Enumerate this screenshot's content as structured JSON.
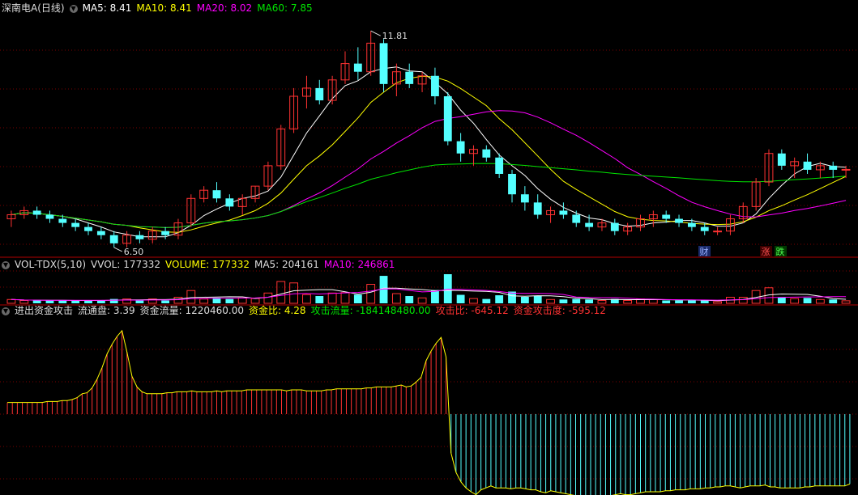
{
  "colors": {
    "up": "#ff3232",
    "down": "#54ffff",
    "ma5": "#ffffff",
    "ma10": "#ffff00",
    "ma20": "#ff00ff",
    "ma60": "#00e600",
    "grid": "#7a0000",
    "label_white": "#dddddd",
    "cyan_text": "#54ffff",
    "green_text": "#00e600",
    "red_text": "#ff3232"
  },
  "icons": {
    "panel_toggle": "circle-chevron-down-icon"
  },
  "main": {
    "title": "深南电A(日线)",
    "ma5": "MA5: 8.41",
    "ma10": "MA10: 8.41",
    "ma20": "MA20: 8.02",
    "ma60": "MA60: 7.85",
    "high_label": "11.81",
    "low_label": "6.50",
    "markers": {
      "cai": "财",
      "zhang": "涨",
      "die": "跌"
    }
  },
  "volume": {
    "title": "VOL-TDX(5,10)",
    "vvol": "VVOL: 177332",
    "volume": "VOLUME: 177332",
    "ma5": "MA5: 204161",
    "ma10": "MA10: 246861"
  },
  "indicator": {
    "title": "进出资金攻击",
    "liutongpan": "流通盘: 3.39",
    "zijinliuliang": "资金流量: 1220460.00",
    "zijinbi": "资金比: 4.28",
    "gongjiliuliang": "攻击流量: -184148480.00",
    "gongjibi": "攻击比: -645.12",
    "zijingongjidu": "资金攻击度: -595.12"
  },
  "chart_data": [
    {
      "type": "candlestick",
      "title": "深南电A(日线)",
      "ylim": [
        6.3,
        12.2
      ],
      "ohlc_approx": [
        [
          7.2,
          7.4,
          7.0,
          7.3
        ],
        [
          7.3,
          7.5,
          7.2,
          7.4
        ],
        [
          7.4,
          7.5,
          7.2,
          7.3
        ],
        [
          7.3,
          7.4,
          7.1,
          7.2
        ],
        [
          7.2,
          7.3,
          7.0,
          7.1
        ],
        [
          7.1,
          7.2,
          6.9,
          7.0
        ],
        [
          7.0,
          7.1,
          6.8,
          6.9
        ],
        [
          6.9,
          7.0,
          6.7,
          6.8
        ],
        [
          6.8,
          6.9,
          6.5,
          6.6
        ],
        [
          6.6,
          6.9,
          6.5,
          6.8
        ],
        [
          6.8,
          6.9,
          6.6,
          6.7
        ],
        [
          6.7,
          7.0,
          6.6,
          6.9
        ],
        [
          6.9,
          7.0,
          6.7,
          6.8
        ],
        [
          6.8,
          7.2,
          6.7,
          7.1
        ],
        [
          7.1,
          7.8,
          7.0,
          7.7
        ],
        [
          7.7,
          8.0,
          7.6,
          7.9
        ],
        [
          7.9,
          8.1,
          7.6,
          7.7
        ],
        [
          7.7,
          7.8,
          7.4,
          7.5
        ],
        [
          7.5,
          7.8,
          7.3,
          7.7
        ],
        [
          7.7,
          8.0,
          7.6,
          8.0
        ],
        [
          8.0,
          8.6,
          7.9,
          8.5
        ],
        [
          8.5,
          9.5,
          8.4,
          9.4
        ],
        [
          9.4,
          10.4,
          9.3,
          10.2
        ],
        [
          10.2,
          10.7,
          9.9,
          10.4
        ],
        [
          10.4,
          10.6,
          10.0,
          10.1
        ],
        [
          10.1,
          10.7,
          10.0,
          10.6
        ],
        [
          10.6,
          11.3,
          10.5,
          11.0
        ],
        [
          11.0,
          11.4,
          10.6,
          10.8
        ],
        [
          10.8,
          11.8,
          10.7,
          11.5
        ],
        [
          11.5,
          11.6,
          10.3,
          10.5
        ],
        [
          10.5,
          11.0,
          10.2,
          10.8
        ],
        [
          10.8,
          11.0,
          10.4,
          10.5
        ],
        [
          10.5,
          10.8,
          10.3,
          10.7
        ],
        [
          10.7,
          10.9,
          10.0,
          10.2
        ],
        [
          10.2,
          10.3,
          9.0,
          9.1
        ],
        [
          9.1,
          9.3,
          8.6,
          8.8
        ],
        [
          8.8,
          9.0,
          8.5,
          8.9
        ],
        [
          8.9,
          9.0,
          8.6,
          8.7
        ],
        [
          8.7,
          8.8,
          8.2,
          8.3
        ],
        [
          8.3,
          8.4,
          7.6,
          7.8
        ],
        [
          7.8,
          8.0,
          7.4,
          7.6
        ],
        [
          7.6,
          7.8,
          7.2,
          7.3
        ],
        [
          7.3,
          7.5,
          7.1,
          7.4
        ],
        [
          7.4,
          7.6,
          7.2,
          7.3
        ],
        [
          7.3,
          7.4,
          7.0,
          7.1
        ],
        [
          7.1,
          7.3,
          6.9,
          7.0
        ],
        [
          7.0,
          7.2,
          6.9,
          7.1
        ],
        [
          7.1,
          7.2,
          6.8,
          6.9
        ],
        [
          6.9,
          7.1,
          6.8,
          7.0
        ],
        [
          7.0,
          7.3,
          6.9,
          7.2
        ],
        [
          7.2,
          7.4,
          7.0,
          7.3
        ],
        [
          7.3,
          7.4,
          7.1,
          7.2
        ],
        [
          7.2,
          7.3,
          7.0,
          7.1
        ],
        [
          7.1,
          7.2,
          6.9,
          7.0
        ],
        [
          7.0,
          7.1,
          6.8,
          6.9
        ],
        [
          6.9,
          7.0,
          6.8,
          6.9
        ],
        [
          6.9,
          7.3,
          6.8,
          7.2
        ],
        [
          7.2,
          7.6,
          7.1,
          7.5
        ],
        [
          7.5,
          8.2,
          7.4,
          8.1
        ],
        [
          8.1,
          8.9,
          8.0,
          8.8
        ],
        [
          8.8,
          8.9,
          8.4,
          8.5
        ],
        [
          8.5,
          8.7,
          8.2,
          8.6
        ],
        [
          8.6,
          8.8,
          8.3,
          8.4
        ],
        [
          8.4,
          8.6,
          8.2,
          8.5
        ],
        [
          8.5,
          8.6,
          8.2,
          8.4
        ],
        [
          8.4,
          8.5,
          8.2,
          8.41
        ]
      ]
    },
    {
      "type": "bar",
      "title": "VOL-TDX(5,10)",
      "series": [
        {
          "name": "VOLUME",
          "values_last": 177332
        },
        {
          "name": "MA5",
          "values_last": 204161
        },
        {
          "name": "MA10",
          "values_last": 246861
        }
      ]
    },
    {
      "type": "bar",
      "title": "进出资金攻击",
      "values": [
        12,
        12,
        12,
        12,
        12,
        12,
        12,
        12,
        13,
        13,
        13,
        14,
        14,
        15,
        17,
        21,
        22,
        27,
        36,
        48,
        62,
        72,
        80,
        86,
        64,
        39,
        28,
        23,
        21,
        21,
        21,
        21,
        22,
        22,
        23,
        23,
        23,
        24,
        23,
        23,
        23,
        23,
        24,
        23,
        24,
        24,
        24,
        24,
        25,
        25,
        25,
        25,
        25,
        25,
        25,
        25,
        24,
        25,
        25,
        25,
        24,
        24,
        24,
        24,
        25,
        25,
        26,
        26,
        26,
        26,
        26,
        26,
        27,
        27,
        28,
        28,
        28,
        28,
        29,
        30,
        28,
        29,
        33,
        38,
        55,
        65,
        73,
        79,
        59,
        -40,
        -60,
        -70,
        -76,
        -80,
        -83,
        -78,
        -76,
        -74,
        -76,
        -76,
        -76,
        -77,
        -76,
        -76,
        -77,
        -78,
        -78,
        -80,
        -81,
        -79,
        -80,
        -81,
        -82,
        -83,
        -84,
        -84,
        -84,
        -84,
        -84,
        -85,
        -84,
        -84,
        -83,
        -82,
        -83,
        -83,
        -82,
        -81,
        -80,
        -80,
        -80,
        -80,
        -79,
        -79,
        -78,
        -78,
        -78,
        -77,
        -77,
        -77,
        -76,
        -76,
        -75,
        -75,
        -74,
        -74,
        -75,
        -76,
        -75,
        -74,
        -74,
        -74,
        -73,
        -75,
        -75,
        -76,
        -76,
        -76,
        -76,
        -76,
        -75,
        -75,
        -74,
        -74,
        -74,
        -74,
        -74,
        -74,
        -74,
        -72
      ]
    }
  ]
}
